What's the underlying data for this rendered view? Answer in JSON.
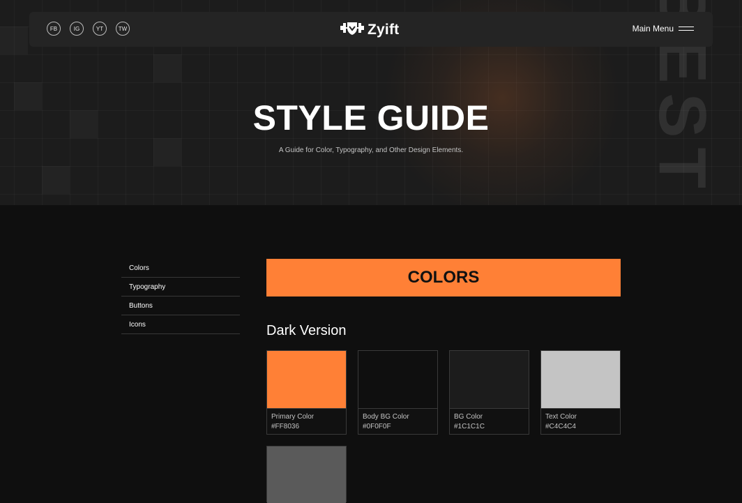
{
  "header": {
    "socials": [
      "FB",
      "IG",
      "YT",
      "TW"
    ],
    "logo_text": "Zyift",
    "logo_icon": "dumbbell-shield-icon",
    "menu_label": "Main Menu",
    "menu_icon": "hamburger-icon"
  },
  "hero": {
    "title": "STYLE GUIDE",
    "subtitle": "A Guide for Color, Typography, and Other Design Elements.",
    "background_word": "BEST"
  },
  "sidebar": {
    "items": [
      {
        "label": "Colors"
      },
      {
        "label": "Typography"
      },
      {
        "label": "Buttons"
      },
      {
        "label": "Icons"
      }
    ]
  },
  "main": {
    "banner_title": "COLORS",
    "section_title": "Dark Version",
    "swatches": [
      {
        "label": "Primary Color",
        "hex": "#FF8036"
      },
      {
        "label": "Body BG Color",
        "hex": "#0F0F0F"
      },
      {
        "label": "BG Color",
        "hex": "#1C1C1C"
      },
      {
        "label": "Text Color",
        "hex": "#C4C4C4"
      },
      {
        "label": "",
        "hex": "",
        "color": "#5A5A5A"
      }
    ]
  },
  "colors": {
    "accent": "#FF8036",
    "body_bg": "#0F0F0F",
    "bg": "#1C1C1C",
    "text": "#C4C4C4"
  }
}
